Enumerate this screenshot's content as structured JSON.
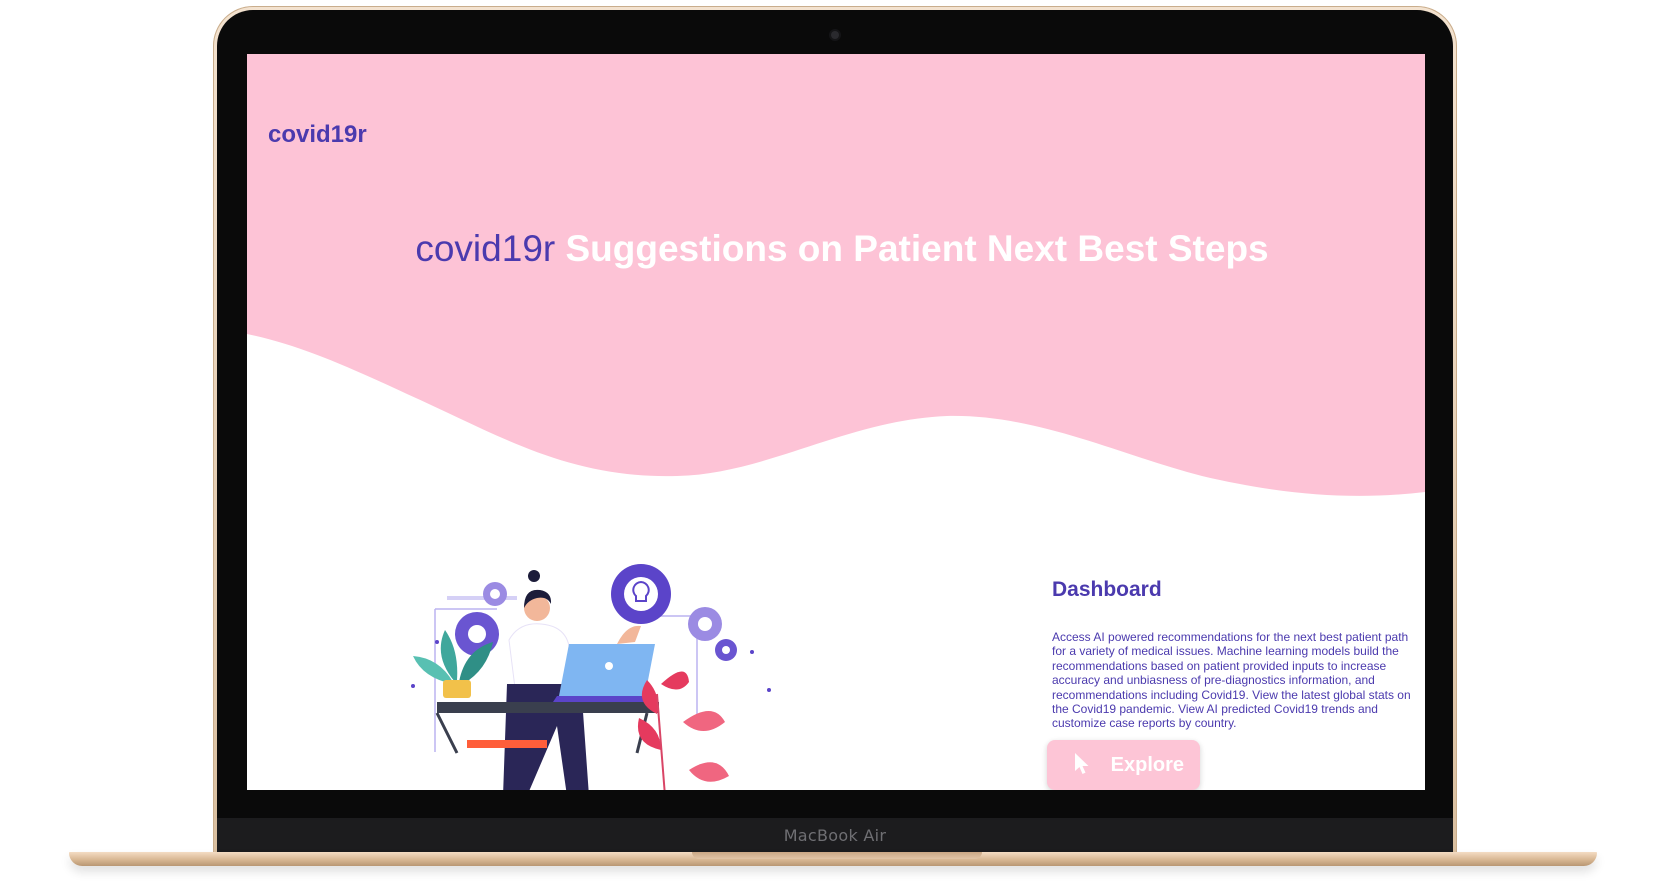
{
  "device": {
    "model_label": "MacBook Air"
  },
  "site": {
    "brand": "covid19r",
    "hero": {
      "brand": "covid19r",
      "title": "Suggestions on Patient Next Best Steps"
    },
    "dashboard": {
      "title": "Dashboard",
      "description_lines": [
        "Access AI powered recommendations for the next best patient path",
        "for a variety of medical issues. Machine learning models build the",
        "recommendations based on patient provided inputs to increase",
        "accuracy and unbiasness of pre-diagnostics information, and",
        "recommendations including Covid19. View the latest global stats on",
        "the Covid19 pandemic. View AI predicted Covid19 trends and",
        "customize case reports by country."
      ],
      "button_label": "Explore",
      "button_icon": "cursor-icon"
    },
    "illustration_icon": "woman-working-laptop-illustration"
  },
  "colors": {
    "hero_bg": "#fdc3d6",
    "brand": "#4b3aae",
    "button_bg": "#fdc5d6",
    "laptop_body": "#e6cdb1"
  }
}
